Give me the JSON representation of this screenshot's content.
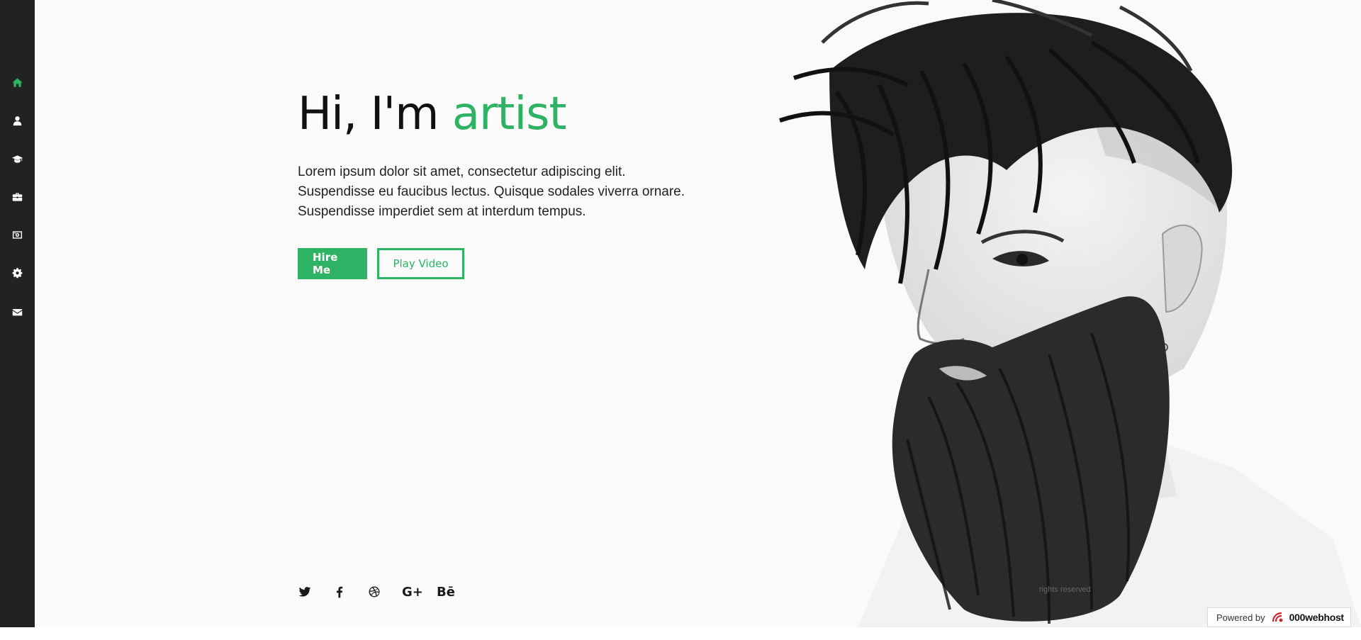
{
  "sidebar": {
    "items": [
      {
        "icon": "home-icon",
        "active": true
      },
      {
        "icon": "user-icon",
        "active": false
      },
      {
        "icon": "graduation-cap-icon",
        "active": false
      },
      {
        "icon": "briefcase-icon",
        "active": false
      },
      {
        "icon": "portfolio-image-icon",
        "active": false
      },
      {
        "icon": "gear-icon",
        "active": false
      },
      {
        "icon": "envelope-icon",
        "active": false
      }
    ]
  },
  "hero": {
    "greeting": "Hi, I'm",
    "highlight": "artist",
    "intro": "Lorem ipsum dolor sit amet, consectetur adipiscing elit. Suspendisse eu faucibus lectus. Quisque sodales viverra ornare. Suspendisse imperdiet sem at interdum tempus.",
    "hire_label": "Hire Me",
    "video_label": "Play Video"
  },
  "social": {
    "icons": [
      "twitter-icon",
      "facebook-icon",
      "dribbble-icon",
      "google-plus-icon",
      "behance-icon"
    ],
    "google_plus_text": "G+",
    "behance_text": "Bē"
  },
  "footer": {
    "copyright": "rights reserved"
  },
  "badge": {
    "powered_by": "Powered by",
    "brand": "000webhost"
  },
  "colors": {
    "accent": "#2eb364",
    "sidebar": "#222222",
    "background": "#fbfbfb"
  }
}
